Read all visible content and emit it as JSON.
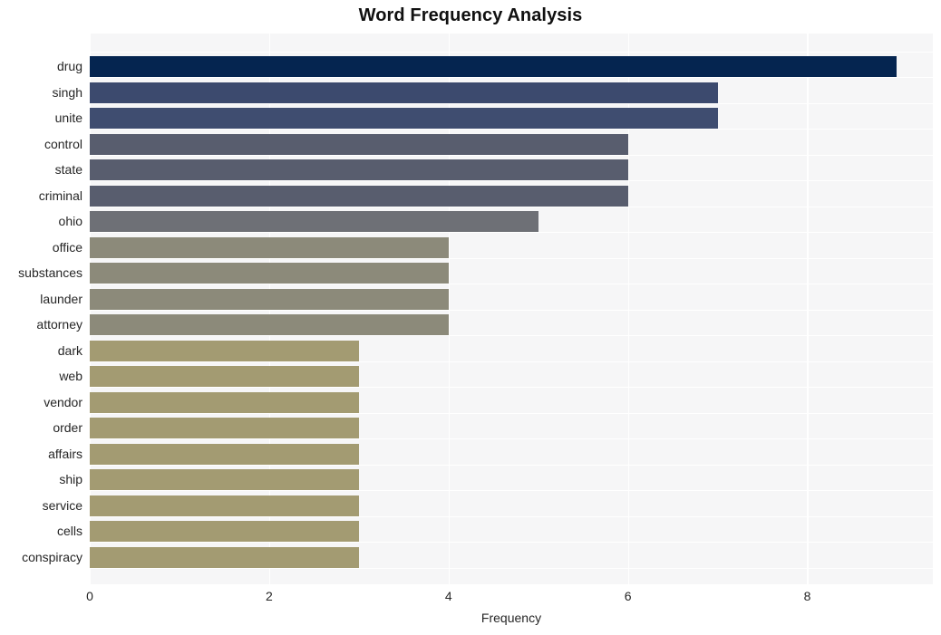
{
  "chart_data": {
    "type": "bar",
    "orientation": "horizontal",
    "title": "Word Frequency Analysis",
    "xlabel": "Frequency",
    "ylabel": "",
    "categories": [
      "drug",
      "singh",
      "unite",
      "control",
      "state",
      "criminal",
      "ohio",
      "office",
      "substances",
      "launder",
      "attorney",
      "dark",
      "web",
      "vendor",
      "order",
      "affairs",
      "ship",
      "service",
      "cells",
      "conspiracy"
    ],
    "values": [
      9,
      7,
      7,
      6,
      6,
      6,
      5,
      4,
      4,
      4,
      4,
      3,
      3,
      3,
      3,
      3,
      3,
      3,
      3,
      3
    ],
    "bar_colors": [
      "#052550",
      "#3c4a6e",
      "#3f4d70",
      "#585d6e",
      "#585d6e",
      "#585d6e",
      "#6e7076",
      "#8c8a7a",
      "#8c8a7a",
      "#8c8a7a",
      "#8c8a7a",
      "#a39b72",
      "#a39b72",
      "#a39b72",
      "#a39b72",
      "#a39b72",
      "#a39b72",
      "#a39b72",
      "#a39b72",
      "#a39b72"
    ],
    "xlim": [
      0,
      9.4
    ],
    "xticks": [
      0,
      2,
      4,
      6,
      8
    ],
    "xtick_labels": [
      "0",
      "2",
      "4",
      "6",
      "8"
    ],
    "grid": true,
    "legend": "none",
    "plot_background": "#f6f6f7",
    "figure_background": "#ffffff",
    "gridline_color": "#ffffff"
  }
}
